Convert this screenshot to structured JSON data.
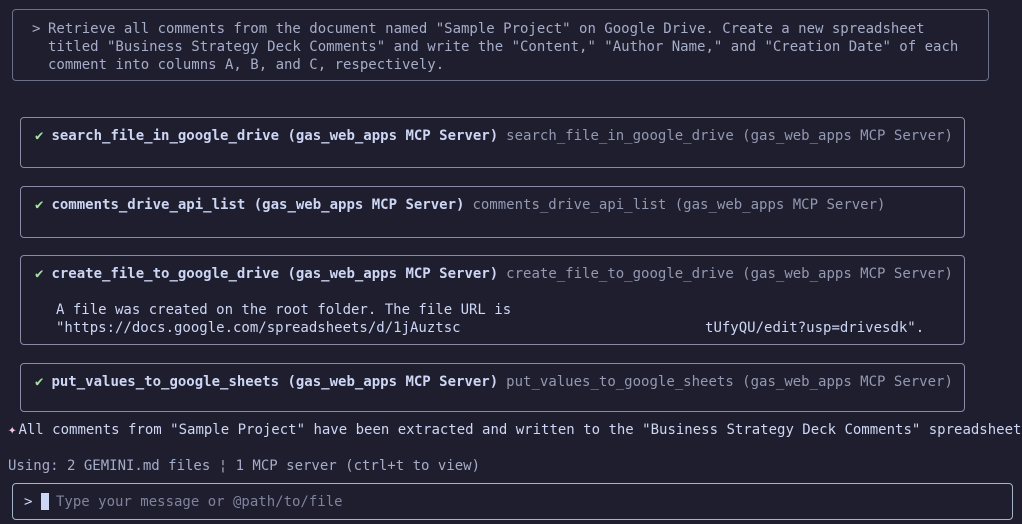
{
  "prompt": {
    "caret": ">",
    "text": "Retrieve all comments from the document named \"Sample Project\" on Google Drive. Create a new spreadsheet titled \"Business Strategy Deck Comments\" and write the \"Content,\" \"Author Name,\" and \"Creation Date\" of each comment into columns A, B, and C, respectively."
  },
  "tools": [
    {
      "status_icon": "✔",
      "name": "search_file_in_google_drive (gas_web_apps MCP Server)",
      "desc": "search_file_in_google_drive (gas_web_apps MCP Server)"
    },
    {
      "status_icon": "✔",
      "name": "comments_drive_api_list (gas_web_apps MCP Server)",
      "desc": "comments_drive_api_list (gas_web_apps MCP Server)"
    },
    {
      "status_icon": "✔",
      "name": "create_file_to_google_drive (gas_web_apps MCP Server)",
      "desc": "create_file_to_google_drive (gas_web_apps MCP Server)",
      "output_line1": "A file was created on the root folder. The file URL is",
      "output_line2": "\"https://docs.google.com/spreadsheets/d/1jAuztsc                             tUfyQU/edit?usp=drivesdk\"."
    },
    {
      "status_icon": "✔",
      "name": "put_values_to_google_sheets (gas_web_apps MCP Server)",
      "desc": "put_values_to_google_sheets (gas_web_apps MCP Server)"
    }
  ],
  "final_message": {
    "icon": "✦",
    "text": "All comments from \"Sample Project\" have been extracted and written to the \"Business Strategy Deck Comments\" spreadsheet."
  },
  "status_bar": {
    "text": "Using: 2 GEMINI.md files ¦ 1 MCP server (ctrl+t to view)"
  },
  "input": {
    "caret": ">",
    "placeholder": "Type your message or @path/to/file"
  },
  "colors": {
    "background": "#1e1e2e",
    "success": "#a6e3a1",
    "sparkle": "#f5c2e7"
  }
}
